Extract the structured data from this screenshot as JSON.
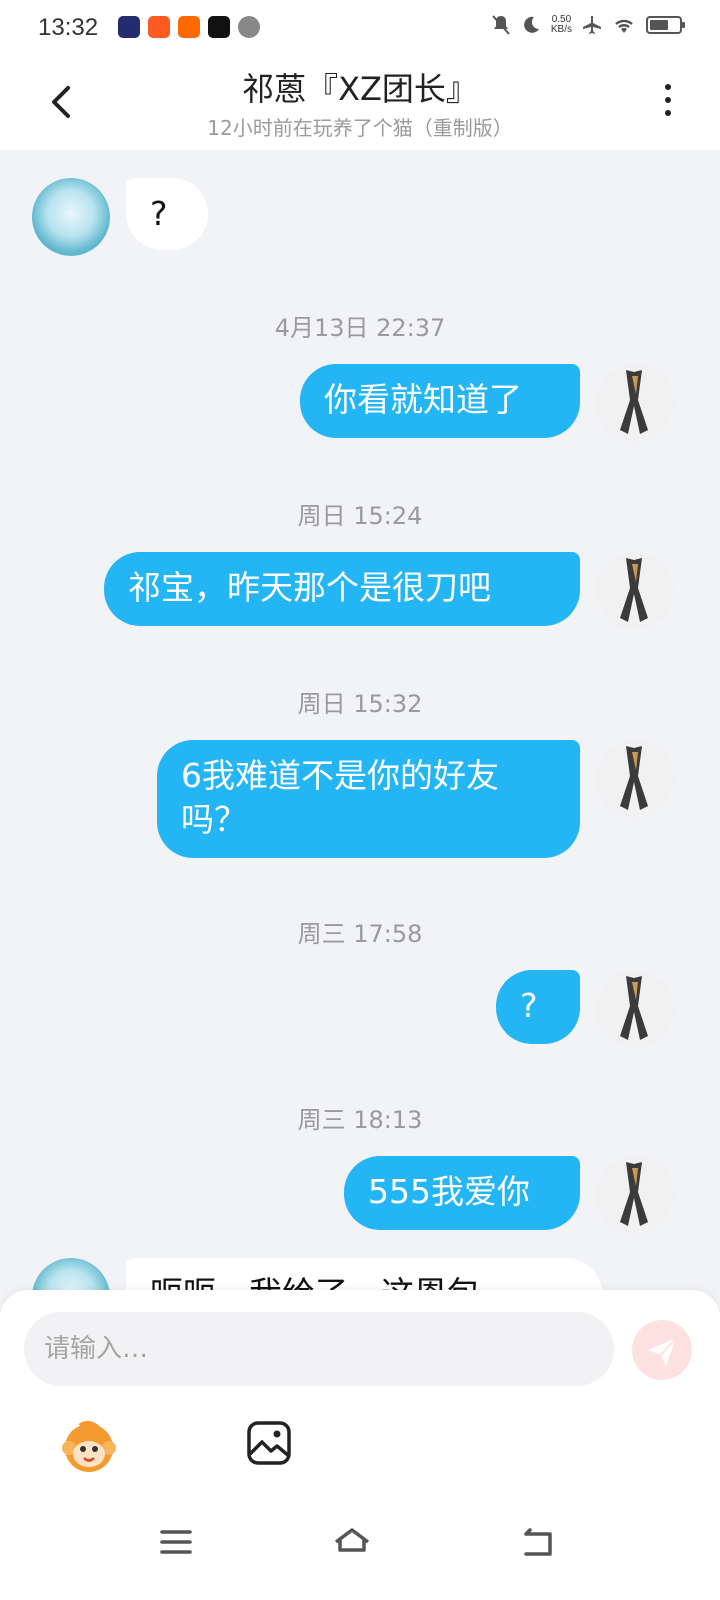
{
  "status_bar": {
    "time": "13:32",
    "net_speed_value": "0.50",
    "net_speed_unit": "KB/s"
  },
  "header": {
    "title": "祁蒽『XZ团长』",
    "subtitle": "12小时前在玩养了个猫（重制版）"
  },
  "messages": [
    {
      "type": "in",
      "text": "?"
    },
    {
      "type": "time",
      "text": "4月13日 22:37"
    },
    {
      "type": "out",
      "text": "你看就知道了"
    },
    {
      "type": "time",
      "text": "周日 15:24"
    },
    {
      "type": "out",
      "text": "祁宝，昨天那个是很刀吧"
    },
    {
      "type": "time",
      "text": "周日 15:32"
    },
    {
      "type": "out",
      "line1": "6我难道不是你的好友",
      "line2": "吗？"
    },
    {
      "type": "time",
      "text": "周三 17:58"
    },
    {
      "type": "out",
      "text": "?"
    },
    {
      "type": "time",
      "text": "周三 18:13"
    },
    {
      "type": "out",
      "text": "555我爱你"
    },
    {
      "type": "in",
      "text": "呃呃，我给了，这恩包"
    }
  ],
  "composer": {
    "placeholder": "请输入…"
  },
  "icons": {
    "back": "back-arrow-icon",
    "more": "more-vertical-icon",
    "send": "send-icon",
    "emoji": "emoji-monkey-icon",
    "image": "image-icon",
    "nav_menu": "menu-icon",
    "nav_home": "home-icon",
    "nav_back": "nav-back-icon"
  },
  "colors": {
    "out_bubble": "#24b5f5",
    "in_bubble": "#ffffff",
    "chat_bg": "#f2f3f7",
    "send_button": "#fde0e0"
  }
}
